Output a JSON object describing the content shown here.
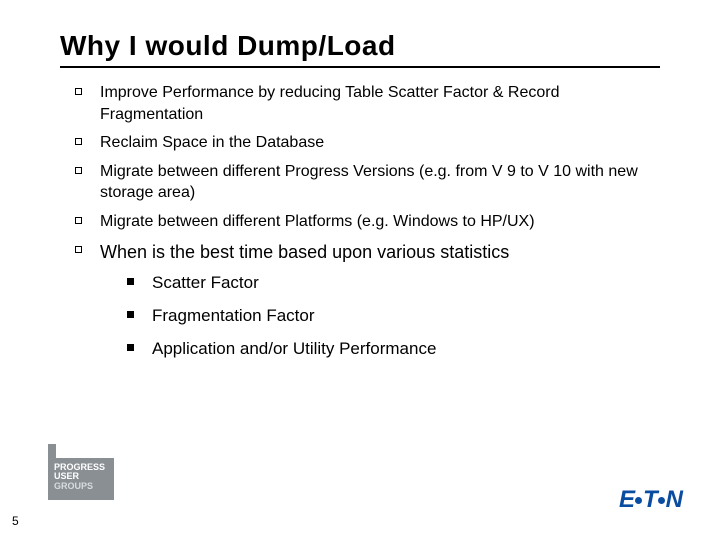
{
  "title": "Why I would Dump/Load",
  "bullets": [
    "Improve Performance by reducing Table Scatter Factor & Record Fragmentation",
    "Reclaim Space in the Database",
    "Migrate between different Progress Versions (e.g. from V 9 to V 10 with new storage area)",
    "Migrate between different Platforms (e.g. Windows to HP/UX)",
    "When is the best time based upon various statistics"
  ],
  "sub_bullets": [
    "Scatter Factor",
    "Fragmentation Factor",
    "Application and/or Utility Performance"
  ],
  "page_number": "5",
  "pug_line1": "PROGRESS",
  "pug_line2": "USER",
  "pug_line3": "GROUPS",
  "eaton_part1": "E",
  "eaton_part2": "T",
  "eaton_part3": "N"
}
